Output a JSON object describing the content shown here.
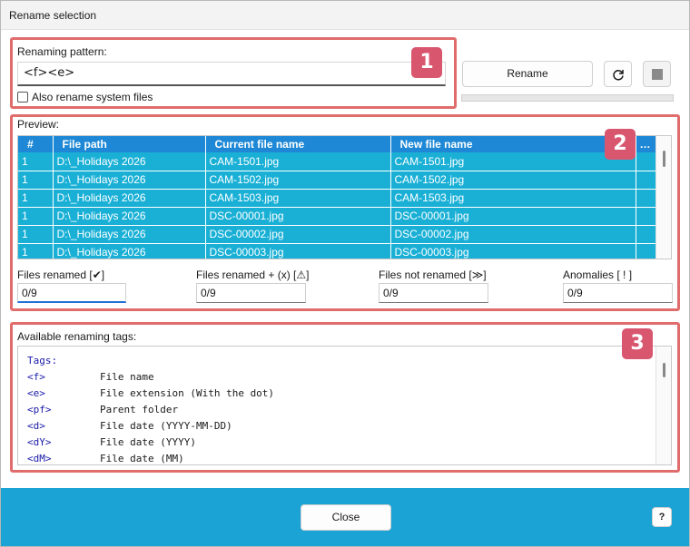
{
  "window": {
    "title": "Rename selection"
  },
  "pattern": {
    "label": "Renaming pattern:",
    "value": "<f><e>",
    "checkbox_label": "Also rename system files"
  },
  "actions": {
    "rename_label": "Rename",
    "refresh_icon": "refresh-icon",
    "stop_icon": "stop-icon"
  },
  "badges": [
    "1",
    "2",
    "3"
  ],
  "preview": {
    "label": "Preview:",
    "columns": [
      "#",
      "File path",
      "Current file name",
      "New file name",
      "…"
    ],
    "rows": [
      [
        "1",
        "D:\\_Holidays 2026",
        "CAM-1501.jpg",
        "CAM-1501.jpg"
      ],
      [
        "1",
        "D:\\_Holidays 2026",
        "CAM-1502.jpg",
        "CAM-1502.jpg"
      ],
      [
        "1",
        "D:\\_Holidays 2026",
        "CAM-1503.jpg",
        "CAM-1503.jpg"
      ],
      [
        "1",
        "D:\\_Holidays 2026",
        "DSC-00001.jpg",
        "DSC-00001.jpg"
      ],
      [
        "1",
        "D:\\_Holidays 2026",
        "DSC-00002.jpg",
        "DSC-00002.jpg"
      ],
      [
        "1",
        "D:\\_Holidays 2026",
        "DSC-00003.jpg",
        "DSC-00003.jpg"
      ]
    ]
  },
  "stats": [
    {
      "label": "Files renamed [✔]",
      "value": "0/9"
    },
    {
      "label": "Files renamed + (x) [⚠]",
      "value": "0/9"
    },
    {
      "label": "Files not renamed [≫]",
      "value": "0/9"
    },
    {
      "label": "Anomalies [ ! ]",
      "value": "0/9"
    }
  ],
  "tags": {
    "label": "Available renaming tags:",
    "header": "Tags:",
    "items": [
      {
        "tag": "<f>",
        "desc": "File name"
      },
      {
        "tag": "<e>",
        "desc": "File extension (With the dot)"
      },
      {
        "tag": "<pf>",
        "desc": "Parent folder"
      },
      {
        "tag": "<d>",
        "desc": "File date (YYYY-MM-DD)"
      },
      {
        "tag": "<dY>",
        "desc": "File date (YYYY)"
      },
      {
        "tag": "<dM>",
        "desc": "File date (MM)"
      }
    ]
  },
  "footer": {
    "close_label": "Close",
    "help_label": "?"
  },
  "colors": {
    "accent": "#1aa3d4",
    "header": "#1e88d6",
    "row": "#1ab0d6",
    "highlight_box": "#e06c6c",
    "badge": "#d9566f",
    "tag_key": "#1a1aa8"
  }
}
